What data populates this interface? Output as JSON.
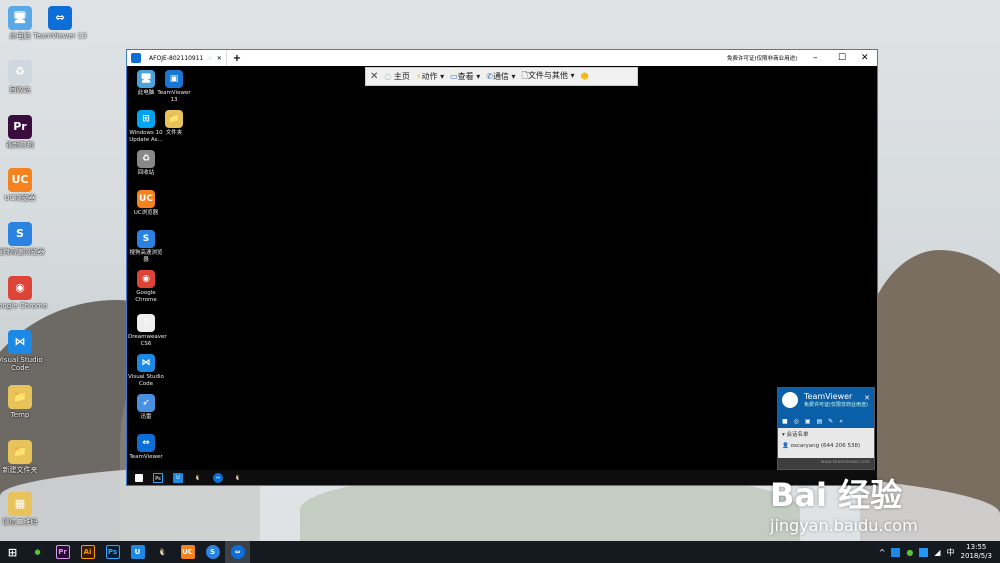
{
  "desktop": {
    "icons": [
      {
        "label": "此电脑",
        "glyph": "🖥",
        "color": "#5aa9e6"
      },
      {
        "label": "TeamViewer 13",
        "glyph": "⇔",
        "color": "#0e6ed8"
      },
      {
        "label": "回收站",
        "glyph": "♻",
        "color": "#cfd8de"
      },
      {
        "label": "视频剪辑",
        "glyph": "Pr",
        "color": "#3b0c3e"
      },
      {
        "label": "UC浏览器",
        "glyph": "UC",
        "color": "#f5821f"
      },
      {
        "label": "搜狗高速浏览器",
        "glyph": "S",
        "color": "#2a83e0"
      },
      {
        "label": "Google Chrome",
        "glyph": "◉",
        "color": "#dc4437"
      },
      {
        "label": "Visual Studio Code",
        "glyph": "⋈",
        "color": "#1e88e5"
      },
      {
        "label": "Temp",
        "glyph": "📁",
        "color": "#e8c25a"
      },
      {
        "label": "新建文件夹",
        "glyph": "📁",
        "color": "#e8c25a"
      },
      {
        "label": "微信二维码",
        "glyph": "▦",
        "color": "#e8c25a"
      }
    ]
  },
  "remote_window": {
    "tab_title": "AFOJE-802110911",
    "new_tab": "+",
    "license_text": "免费许可证(仅限非商业用途)",
    "toolbar": {
      "close": "✕",
      "home": "主页",
      "actions": "动作",
      "view": "查看",
      "communicate": "通信",
      "files": "文件与其他"
    },
    "remote_icons": [
      {
        "label": "此电脑",
        "glyph": "🖥",
        "color": "#4aa3df"
      },
      {
        "label": "TeamViewer 13",
        "glyph": "▣",
        "color": "#1976d2"
      },
      {
        "label": "Windows 10 Update As...",
        "glyph": "⊞",
        "color": "#00a4ef"
      },
      {
        "label": "文件夹",
        "glyph": "📁",
        "color": "#e8c25a"
      },
      {
        "label": "回收站",
        "glyph": "♻",
        "color": "#888"
      },
      {
        "label": "UC浏览器",
        "glyph": "UC",
        "color": "#f5821f"
      },
      {
        "label": "搜狗高速浏览器",
        "glyph": "S",
        "color": "#2a83e0"
      },
      {
        "label": "Google Chrome",
        "glyph": "◉",
        "color": "#dc4437"
      },
      {
        "label": "Dreamweaver CS6",
        "glyph": "▯",
        "color": "#eee"
      },
      {
        "label": "Visual Studio Code",
        "glyph": "⋈",
        "color": "#1e88e5"
      },
      {
        "label": "迅雷",
        "glyph": "➶",
        "color": "#4a90e2"
      },
      {
        "label": "TeamViewer",
        "glyph": "⇔",
        "color": "#0e6ed8"
      }
    ],
    "tv_panel": {
      "title": "TeamViewer",
      "subtitle": "免费许可证(仅限非商业用途)",
      "section": "会话名单",
      "session": "oscaryang (644 206 538)",
      "footer": "www.teamviewer.com"
    }
  },
  "taskbar": {
    "time": "13:55",
    "date": "2018/5/3",
    "ime": "中"
  },
  "watermark": {
    "logo": "Bai 经验",
    "url": "jingyan.baidu.com"
  }
}
